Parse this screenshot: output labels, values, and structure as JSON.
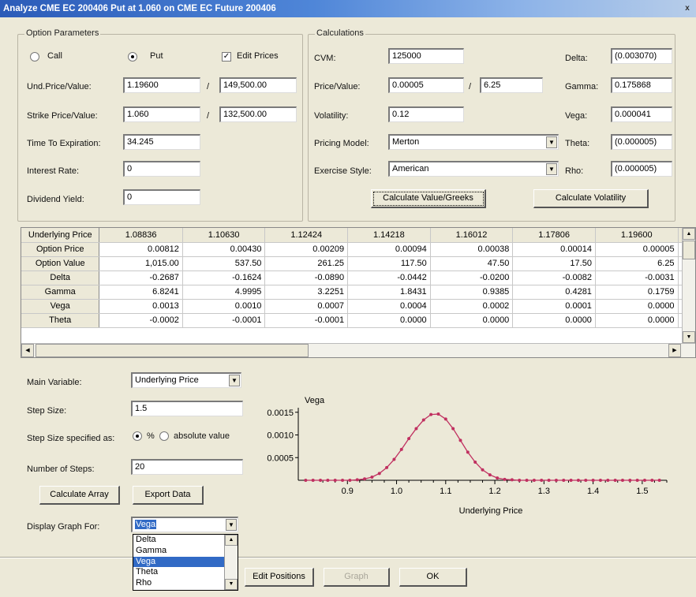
{
  "window": {
    "title": "Analyze CME EC 200406 Put at 1.060 on CME EC Future 200406",
    "close": "x"
  },
  "option_params": {
    "group_title": "Option Parameters",
    "call_label": "Call",
    "put_label": "Put",
    "call_selected": false,
    "put_selected": true,
    "edit_prices_label": "Edit Prices",
    "edit_prices_checked": true,
    "und_price_label": "Und.Price/Value:",
    "und_price": "1.19600",
    "und_value": "149,500.00",
    "strike_label": "Strike Price/Value:",
    "strike_price": "1.060",
    "strike_value": "132,500.00",
    "slash": "/",
    "time_label": "Time To Expiration:",
    "time": "34.245",
    "rate_label": "Interest Rate:",
    "rate": "0",
    "dividend_label": "Dividend Yield:",
    "dividend": "0"
  },
  "calculations": {
    "group_title": "Calculations",
    "cvm_label": "CVM:",
    "cvm": "125000",
    "price_label": "Price/Value:",
    "price": "0.00005",
    "value": "6.25",
    "vol_label": "Volatility:",
    "vol": "0.12",
    "model_label": "Pricing Model:",
    "model": "Merton",
    "exercise_label": "Exercise Style:",
    "exercise": "American",
    "calc_value_btn": "Calculate Value/Greeks",
    "calc_vol_btn": "Calculate Volatility",
    "greeks": [
      {
        "label": "Delta:",
        "value": "(0.003070)"
      },
      {
        "label": "Gamma:",
        "value": "0.175868"
      },
      {
        "label": "Vega:",
        "value": "0.000041"
      },
      {
        "label": "Theta:",
        "value": "(0.000005)"
      },
      {
        "label": "Rho:",
        "value": "(0.000005)"
      }
    ]
  },
  "grid": {
    "header_label": "Underlying Price",
    "columns": [
      "1.08836",
      "1.10630",
      "1.12424",
      "1.14218",
      "1.16012",
      "1.17806",
      "1.19600"
    ],
    "rows": [
      {
        "label": "Option Price",
        "values": [
          "0.00812",
          "0.00430",
          "0.00209",
          "0.00094",
          "0.00038",
          "0.00014",
          "0.00005"
        ]
      },
      {
        "label": "Option Value",
        "values": [
          "1,015.00",
          "537.50",
          "261.25",
          "117.50",
          "47.50",
          "17.50",
          "6.25"
        ]
      },
      {
        "label": "Delta",
        "values": [
          "-0.2687",
          "-0.1624",
          "-0.0890",
          "-0.0442",
          "-0.0200",
          "-0.0082",
          "-0.0031"
        ]
      },
      {
        "label": "Gamma",
        "values": [
          "6.8241",
          "4.9995",
          "3.2251",
          "1.8431",
          "0.9385",
          "0.4281",
          "0.1759"
        ]
      },
      {
        "label": "Vega",
        "values": [
          "0.0013",
          "0.0010",
          "0.0007",
          "0.0004",
          "0.0002",
          "0.0001",
          "0.0000"
        ]
      },
      {
        "label": "Theta",
        "values": [
          "-0.0002",
          "-0.0001",
          "-0.0001",
          "0.0000",
          "0.0000",
          "0.0000",
          "0.0000"
        ]
      }
    ]
  },
  "array_controls": {
    "main_var_label": "Main Variable:",
    "main_var": "Underlying Price",
    "step_size_label": "Step Size:",
    "step_size": "1.5",
    "step_spec_label": "Step Size specified as:",
    "pct_label": "%",
    "abs_label": "absolute value",
    "pct_selected": true,
    "num_steps_label": "Number of Steps:",
    "num_steps": "20",
    "calc_array_btn": "Calculate Array",
    "export_btn": "Export Data",
    "display_label": "Display Graph For:",
    "display_value": "Vega",
    "options": [
      "Delta",
      "Gamma",
      "Vega",
      "Theta",
      "Rho"
    ],
    "selected_option": "Vega"
  },
  "bottom_buttons": {
    "edit_positions": "Edit Positions",
    "graph": "Graph",
    "ok": "OK"
  },
  "chart_data": {
    "type": "line",
    "title": "",
    "ylabel": "Vega",
    "xlabel": "Underlying Price",
    "x_ticks": [
      "0.9",
      "1.0",
      "1.1",
      "1.2",
      "1.3",
      "1.4",
      "1.5"
    ],
    "y_ticks": [
      "0.0015",
      "0.0010",
      "0.0005"
    ],
    "xlim": [
      0.8,
      1.55
    ],
    "ylim": [
      0,
      0.0016
    ],
    "color": "#c03060",
    "series": [
      {
        "x": [
          0.815,
          0.83,
          0.845,
          0.86,
          0.875,
          0.89,
          0.905,
          0.92,
          0.935,
          0.95,
          0.965,
          0.98,
          0.995,
          1.01,
          1.025,
          1.04,
          1.055,
          1.07,
          1.085,
          1.1,
          1.115,
          1.13,
          1.145,
          1.16,
          1.175,
          1.19,
          1.205,
          1.22,
          1.235,
          1.25,
          1.265,
          1.28,
          1.295,
          1.31,
          1.325,
          1.34,
          1.355,
          1.37,
          1.385,
          1.4,
          1.415,
          1.43,
          1.445,
          1.46,
          1.475,
          1.49,
          1.505,
          1.52,
          1.535
        ],
        "y": [
          0,
          0,
          0,
          0,
          0,
          0,
          0,
          1e-05,
          3e-05,
          7e-05,
          0.00015,
          0.00028,
          0.00046,
          0.00068,
          0.00092,
          0.00114,
          0.00133,
          0.00145,
          0.00146,
          0.00135,
          0.00114,
          0.00088,
          0.00062,
          0.0004,
          0.00023,
          0.00012,
          5e-05,
          2e-05,
          1e-05,
          0,
          0,
          0,
          0,
          0,
          0,
          0,
          0,
          0,
          0,
          0,
          0,
          0,
          0,
          0,
          0,
          0,
          0,
          0,
          0
        ]
      }
    ]
  }
}
